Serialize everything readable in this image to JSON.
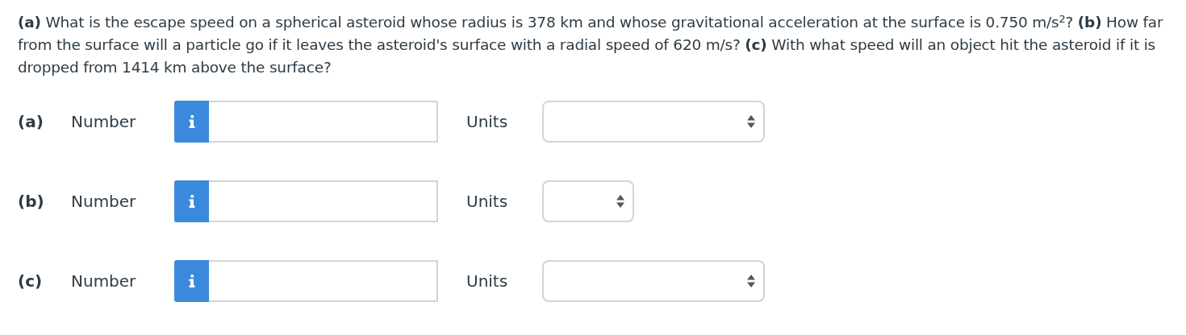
{
  "question": "**(a)** What is the escape speed on a spherical asteroid whose radius is 378 km and whose gravitational acceleration at the surface is 0.750 m/s$^{2}$? **(b)** How far from the surface will a particle go if it leaves the asteroid's surface with a radial speed of 620 m/s? **(c)** With what speed will an object hit the asteroid if it is dropped from 1414 km above the surface?",
  "parts": [
    {
      "label": "(a)",
      "number_label": "Number",
      "units_label": "Units",
      "kind": "wide"
    },
    {
      "label": "(b)",
      "number_label": "Number",
      "units_label": "Units",
      "kind": "narrow"
    },
    {
      "label": "(c)",
      "number_label": "Number",
      "units_label": "Units",
      "kind": "wide"
    }
  ]
}
